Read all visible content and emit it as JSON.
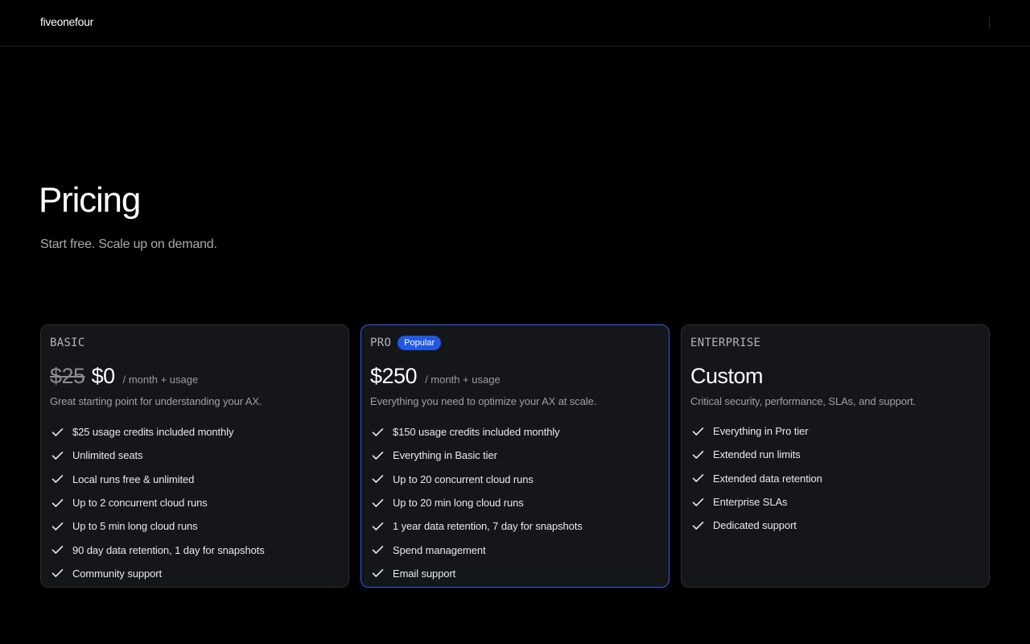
{
  "header": {
    "logo": "fiveonefour"
  },
  "hero": {
    "title": "Pricing",
    "subtitle": "Start free. Scale up on demand."
  },
  "plans": [
    {
      "tier": "BASIC",
      "badge": "",
      "price_old": "$25",
      "price": "$0",
      "price_unit": "/ month + usage",
      "description": "Great starting point for understanding your AX.",
      "features": [
        "$25 usage credits included monthly",
        "Unlimited seats",
        "Local runs free & unlimited",
        "Up to 2 concurrent cloud runs",
        "Up to 5 min long cloud runs",
        "90 day data retention, 1 day for snapshots",
        "Community support"
      ]
    },
    {
      "tier": "PRO",
      "badge": "Popular",
      "price_old": "",
      "price": "$250",
      "price_unit": "/ month + usage",
      "description": "Everything you need to optimize your AX at scale.",
      "features": [
        "$150 usage credits included monthly",
        "Everything in Basic tier",
        "Up to 20 concurrent cloud runs",
        "Up to 20 min long cloud runs",
        "1 year data retention, 7 day for snapshots",
        "Spend management",
        "Email support"
      ]
    },
    {
      "tier": "ENTERPRISE",
      "badge": "",
      "price_old": "",
      "price": "Custom",
      "price_unit": "",
      "description": "Critical security, performance, SLAs, and support.",
      "features": [
        "Everything in Pro tier",
        "Extended run limits",
        "Extended data retention",
        "Enterprise SLAs",
        "Dedicated support"
      ]
    }
  ],
  "icons": {
    "feature": "check-icon"
  },
  "colors": {
    "background": "#000000",
    "card": "#141619",
    "accent": "#2157e4",
    "pro_border": "#2f5fe8"
  }
}
